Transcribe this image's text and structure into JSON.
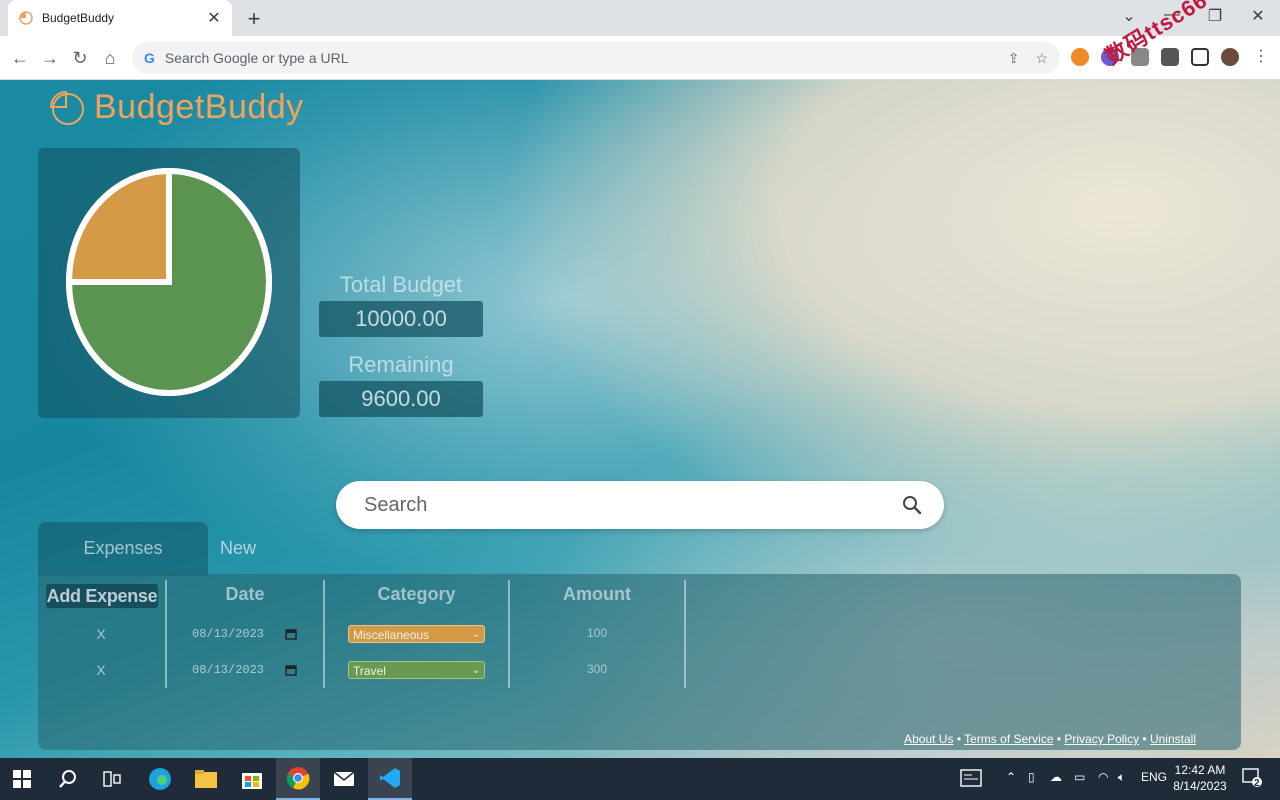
{
  "browser": {
    "tab_title": "BudgetBuddy",
    "tab_close": "✕",
    "new_tab": "+",
    "omnibox_placeholder": "Search Google or type a URL",
    "window_controls": {
      "minimize": "—",
      "restore": "❐",
      "close": "✕",
      "tab_search": "⌄"
    }
  },
  "app": {
    "brand": "BudgetBuddy",
    "brand_color": "#f0a35c",
    "pie": {
      "slices": [
        {
          "label": "Miscellaneous",
          "value": 100,
          "color": "#d49a45"
        },
        {
          "label": "Remaining",
          "value": 300,
          "color": "#5a9450"
        }
      ]
    },
    "total_budget_label": "Total Budget",
    "total_budget_value": "10000.00",
    "remaining_label": "Remaining",
    "remaining_value": "9600.00",
    "search_placeholder": "Search",
    "tabs": {
      "expenses": "Expenses",
      "new": "New"
    },
    "table": {
      "add_button": "Add Expense",
      "headers": {
        "date": "Date",
        "category": "Category",
        "amount": "Amount"
      },
      "rows": [
        {
          "delete": "X",
          "date": "08/13/2023",
          "category": "Miscellaneous",
          "category_color": "#d49a45",
          "amount": "100"
        },
        {
          "delete": "X",
          "date": "08/13/2023",
          "category": "Travel",
          "category_color": "#6a9a4f",
          "amount": "300"
        }
      ]
    },
    "footer": {
      "about": "About Us",
      "terms": "Terms of Service",
      "privacy": "Privacy Policy",
      "uninstall": "Uninstall",
      "separator": "•"
    },
    "watermark": "数码ttsc66"
  },
  "taskbar": {
    "language": "ENG",
    "time": "12:42 AM",
    "date": "8/14/2023",
    "notification_count": "2"
  }
}
